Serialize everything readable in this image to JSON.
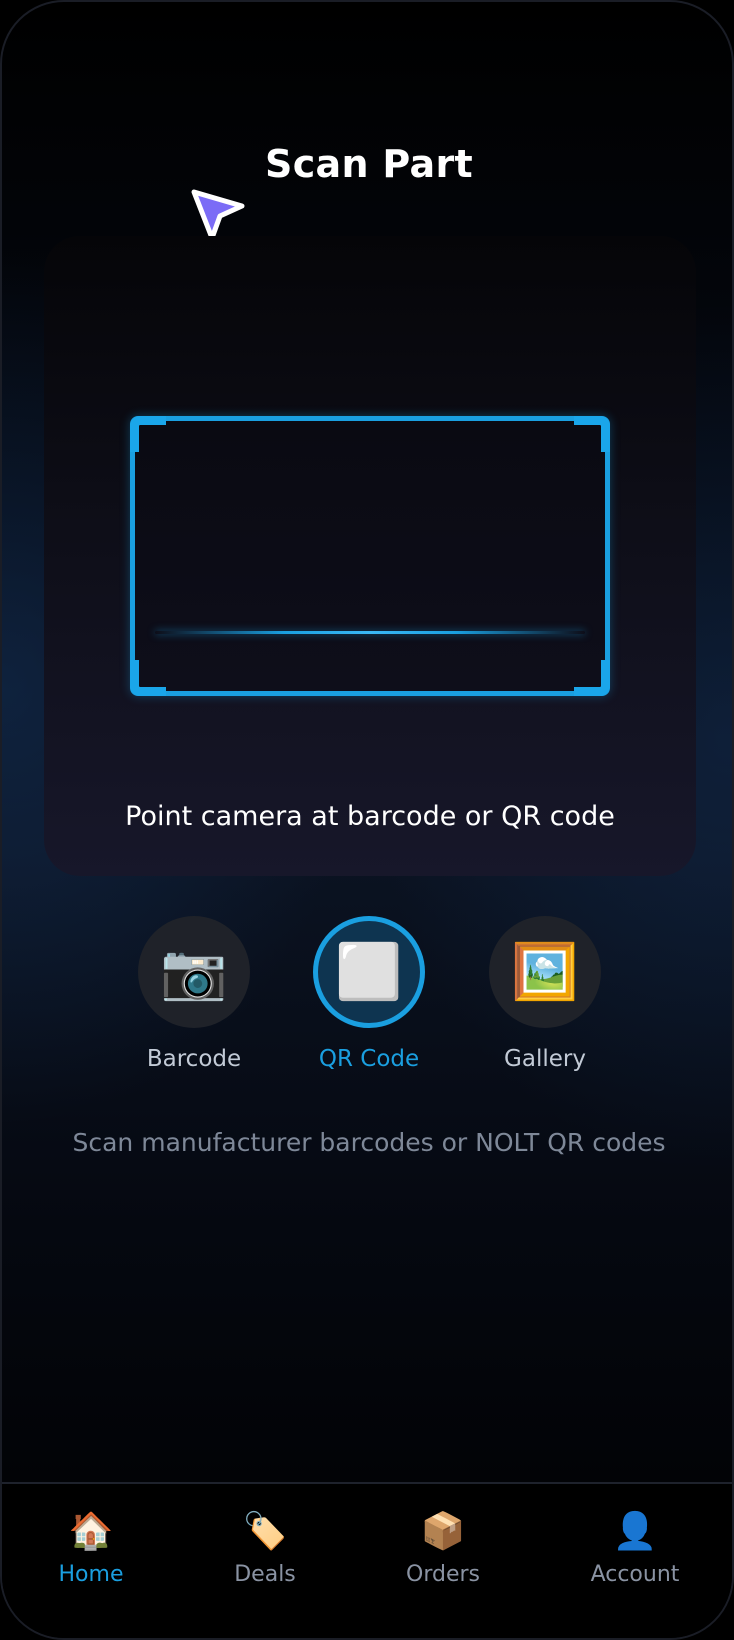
{
  "header": {
    "title": "Scan Part"
  },
  "scanner": {
    "instruction": "Point camera at barcode or QR code"
  },
  "modes": [
    {
      "label": "Barcode",
      "icon": "camera-icon",
      "glyph": "📷",
      "active": false
    },
    {
      "label": "QR Code",
      "icon": "qr-square-icon",
      "glyph": "⬜",
      "active": true
    },
    {
      "label": "Gallery",
      "icon": "picture-frame-icon",
      "glyph": "🖼️",
      "active": false
    }
  ],
  "hint": "Scan manufacturer barcodes or NOLT QR codes",
  "bottom_nav": {
    "items": [
      {
        "label": "Home",
        "icon": "house-icon",
        "glyph": "🏠",
        "active": true
      },
      {
        "label": "Deals",
        "icon": "tag-icon",
        "glyph": "🏷️",
        "active": false
      },
      {
        "label": "Orders",
        "icon": "package-icon",
        "glyph": "📦",
        "active": false
      },
      {
        "label": "Account",
        "icon": "user-icon",
        "glyph": "👤",
        "active": false
      }
    ]
  },
  "colors": {
    "accent": "#1a9fe0",
    "cursor": "#7b6cf6",
    "text_primary": "#ffffff",
    "text_muted": "#7e8898",
    "nav_inactive": "#8a93a3"
  }
}
